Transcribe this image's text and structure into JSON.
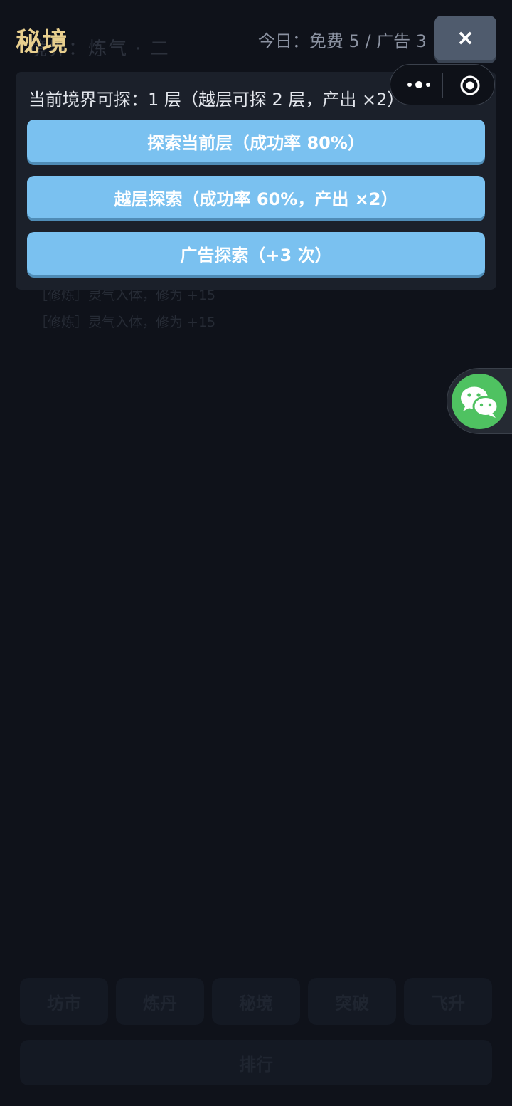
{
  "background": {
    "realm_text": "境界：炼气 · 二",
    "log_lines": [
      "［修炼］灵气入体，修为 +15",
      "［修炼］灵气入体，修为 +15"
    ],
    "nav": [
      "坊市",
      "炼丹",
      "秘境",
      "突破",
      "飞升"
    ],
    "rank_label": "排行"
  },
  "modal": {
    "title": "秘境",
    "quota": "今日：免费 5 / 广告 3",
    "close_label": "×",
    "info": "当前境界可探：1 层（越层可探 2 层，产出 ×2）",
    "buttons": {
      "explore_current": "探索当前层（成功率 80%）",
      "explore_skip": "越层探索（成功率 60%，产出 ×2）",
      "ad_explore": "广告探索（+3 次）"
    }
  },
  "icons": {
    "capsule_more": "more-dots-icon",
    "capsule_close": "target-circle-icon",
    "share": "wechat-icon"
  },
  "colors": {
    "title": "#e8cf8e",
    "button": "#7ac1f0",
    "close_button": "#4f5b6d",
    "wechat": "#4fc261"
  }
}
